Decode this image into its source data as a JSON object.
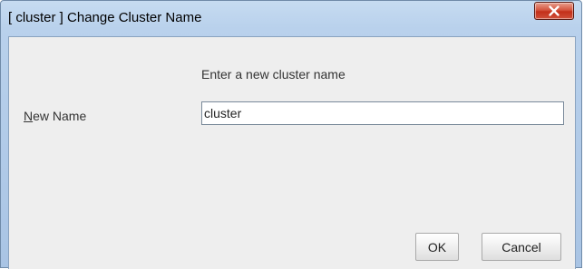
{
  "window": {
    "title": "[ cluster ] Change Cluster Name",
    "close_icon": "close-x-icon"
  },
  "form": {
    "prompt": "Enter a new cluster name",
    "label_mnemonic": "N",
    "label_rest": "ew Name",
    "name_value": "cluster"
  },
  "buttons": {
    "ok_label": "OK",
    "cancel_label": "Cancel"
  },
  "colors": {
    "titlebar": "#b9d1ec",
    "close_button": "#c3301a",
    "dialog_background": "#eeeeee"
  }
}
